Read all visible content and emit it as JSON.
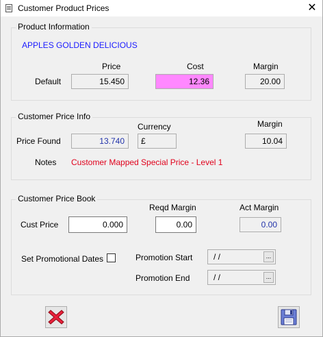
{
  "window": {
    "title": "Customer Product Prices",
    "close_glyph": "✕"
  },
  "product_info": {
    "group_label": "Product Information",
    "product_name": "APPLES GOLDEN DELICIOUS",
    "col_price": "Price",
    "col_cost": "Cost",
    "col_margin": "Margin",
    "row_label": "Default",
    "price": "15.450",
    "cost": "12.36",
    "margin": "20.00",
    "cost_highlight_color": "#ff88ff"
  },
  "customer_price_info": {
    "group_label": "Customer Price Info",
    "price_found_label": "Price Found",
    "price_found": "13.740",
    "currency_label": "Currency",
    "currency": "£",
    "margin_label": "Margin",
    "margin": "10.04",
    "notes_label": "Notes",
    "notes": "Customer Mapped Special Price - Level 1"
  },
  "customer_price_book": {
    "group_label": "Customer Price Book",
    "cust_price_label": "Cust Price",
    "cust_price": "0.000",
    "reqd_margin_label": "Reqd Margin",
    "reqd_margin": "0.00",
    "act_margin_label": "Act Margin",
    "act_margin": "0.00",
    "set_promo_label": "Set Promotional Dates",
    "set_promo_checked": false,
    "promo_start_label": "Promotion Start",
    "promo_start": "/  /",
    "promo_end_label": "Promotion End",
    "promo_end": "/  /",
    "ellipsis": "..."
  },
  "buttons": {
    "cancel_icon": "cancel-x-icon",
    "save_icon": "floppy-disk-icon"
  }
}
